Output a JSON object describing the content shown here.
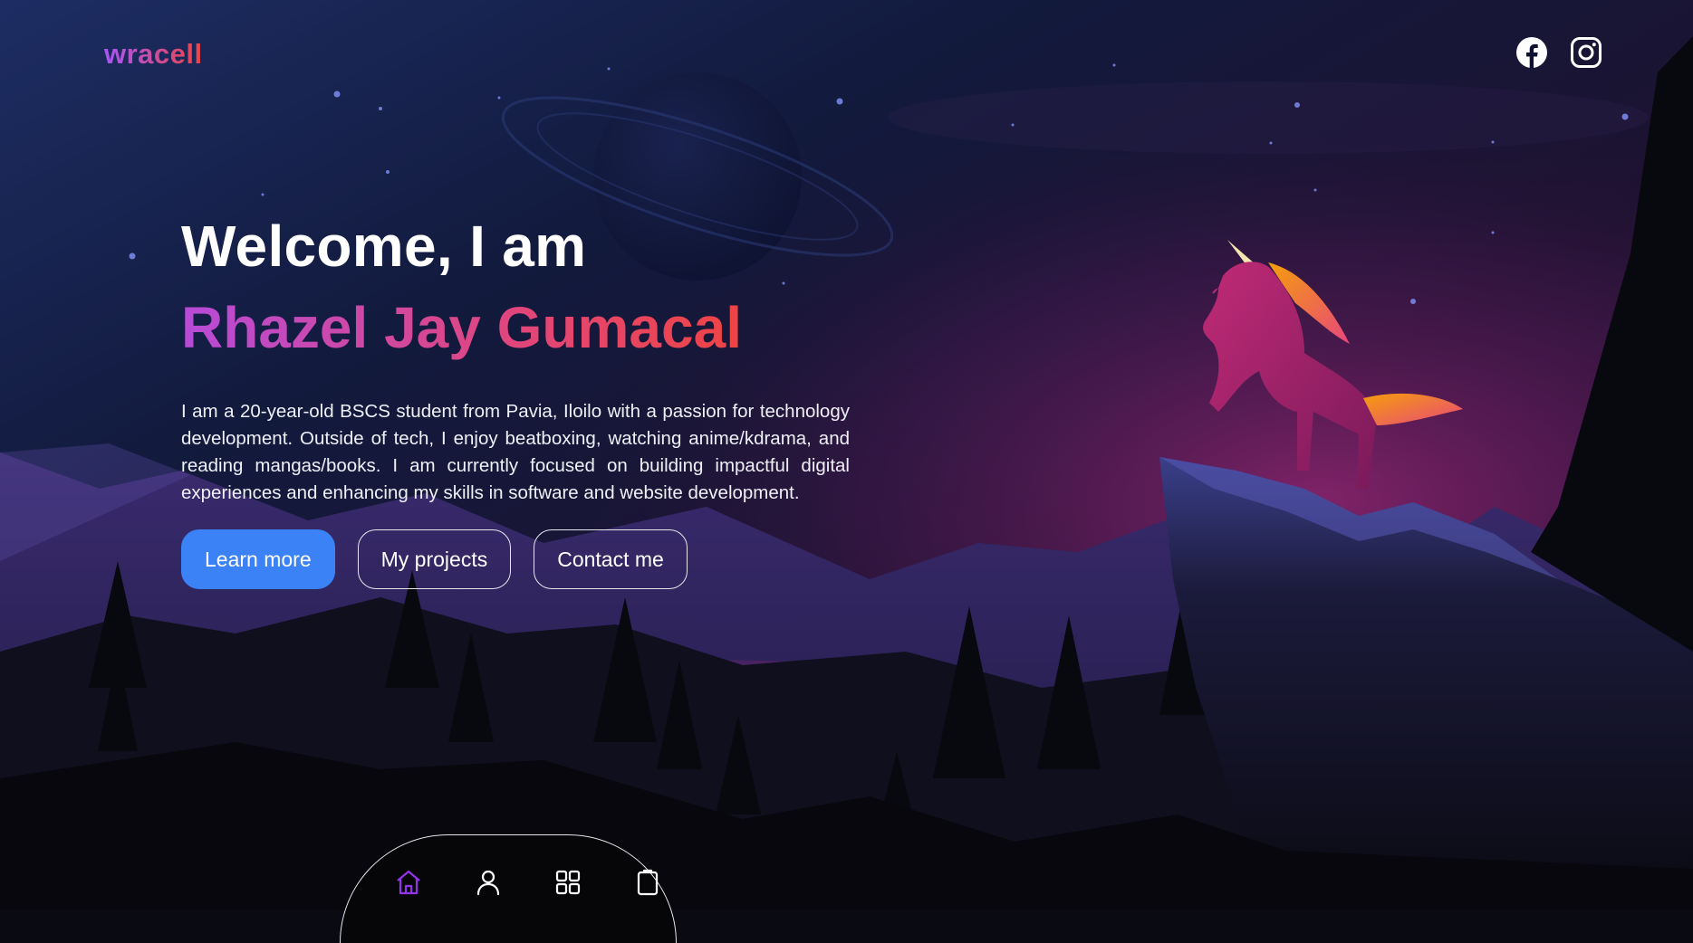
{
  "brand": {
    "name": "wracell"
  },
  "header": {
    "social": [
      {
        "icon": "facebook-icon"
      },
      {
        "icon": "instagram-icon"
      }
    ]
  },
  "hero": {
    "greeting": "Welcome, I am",
    "name": "Rhazel Jay Gumacal",
    "description": "I am a 20-year-old BSCS student from Pavia, Iloilo with a passion for technology development. Outside of tech, I enjoy beatboxing, watching anime/kdrama, and reading mangas/books. I am currently focused on building impactful digital experiences and enhancing my skills in software and website development."
  },
  "buttons": {
    "learn_more": "Learn more",
    "projects": "My projects",
    "contact": "Contact me"
  },
  "dock": {
    "items": [
      {
        "icon": "home-icon",
        "active": true
      },
      {
        "icon": "user-icon",
        "active": false
      },
      {
        "icon": "grid-icon",
        "active": false
      },
      {
        "icon": "clipboard-icon",
        "active": false
      }
    ]
  },
  "colors": {
    "accent": "#3b82f6",
    "name_gradient_start": "#b74bd8",
    "name_gradient_end": "#ef4444",
    "dock_active": "#9333ea"
  }
}
